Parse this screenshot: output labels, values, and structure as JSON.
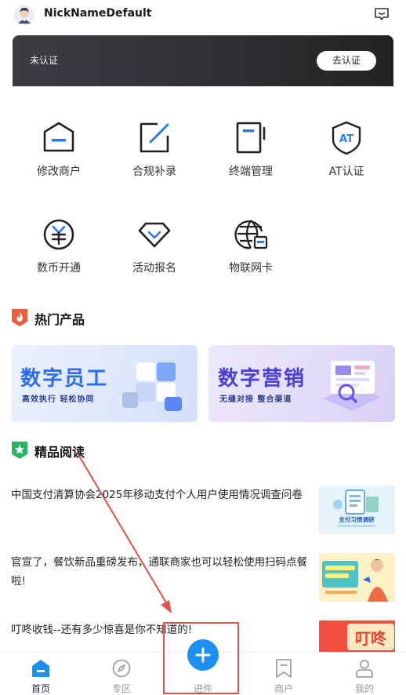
{
  "header": {
    "nickname": "NickNameDefault"
  },
  "banner": {
    "status": "未认证",
    "action": "去认证"
  },
  "grid": [
    {
      "label": "修改商户",
      "icon": "store-edit-icon"
    },
    {
      "label": "合规补录",
      "icon": "edit-box-icon"
    },
    {
      "label": "终端管理",
      "icon": "terminal-icon"
    },
    {
      "label": "AT认证",
      "icon": "at-shield-icon"
    },
    {
      "label": "数币开通",
      "icon": "digital-currency-icon"
    },
    {
      "label": "活动报名",
      "icon": "diamond-icon"
    },
    {
      "label": "物联网卡",
      "icon": "globe-card-icon"
    }
  ],
  "hot": {
    "title": "热门产品",
    "cards": [
      {
        "title": "数字员工",
        "subtitle": "高效执行  轻松协同"
      },
      {
        "title": "数字营销",
        "subtitle": "无缝对接  整合渠道"
      }
    ]
  },
  "reading": {
    "title": "精品阅读",
    "articles": [
      {
        "text": "中国支付清算协会2025年移动支付个人用户使用情况调查问卷",
        "thumb_caption": "支付习惯调研"
      },
      {
        "text": "官宣了，餐饮新品重磅发布，通联商家也可以轻松使用扫码点餐啦!",
        "thumb_caption": ""
      },
      {
        "text": "叮咚收钱--还有多少惊喜是你不知道的!",
        "thumb_caption": "叮咚"
      }
    ]
  },
  "tabs": [
    {
      "label": "首页",
      "icon": "home-icon"
    },
    {
      "label": "专区",
      "icon": "compass-icon"
    },
    {
      "label": "进件",
      "icon": "plus-icon"
    },
    {
      "label": "商户",
      "icon": "bookmark-icon"
    },
    {
      "label": "我的",
      "icon": "user-icon"
    }
  ],
  "colors": {
    "accent": "#1d8ff0",
    "annotation": "#e2514c"
  }
}
